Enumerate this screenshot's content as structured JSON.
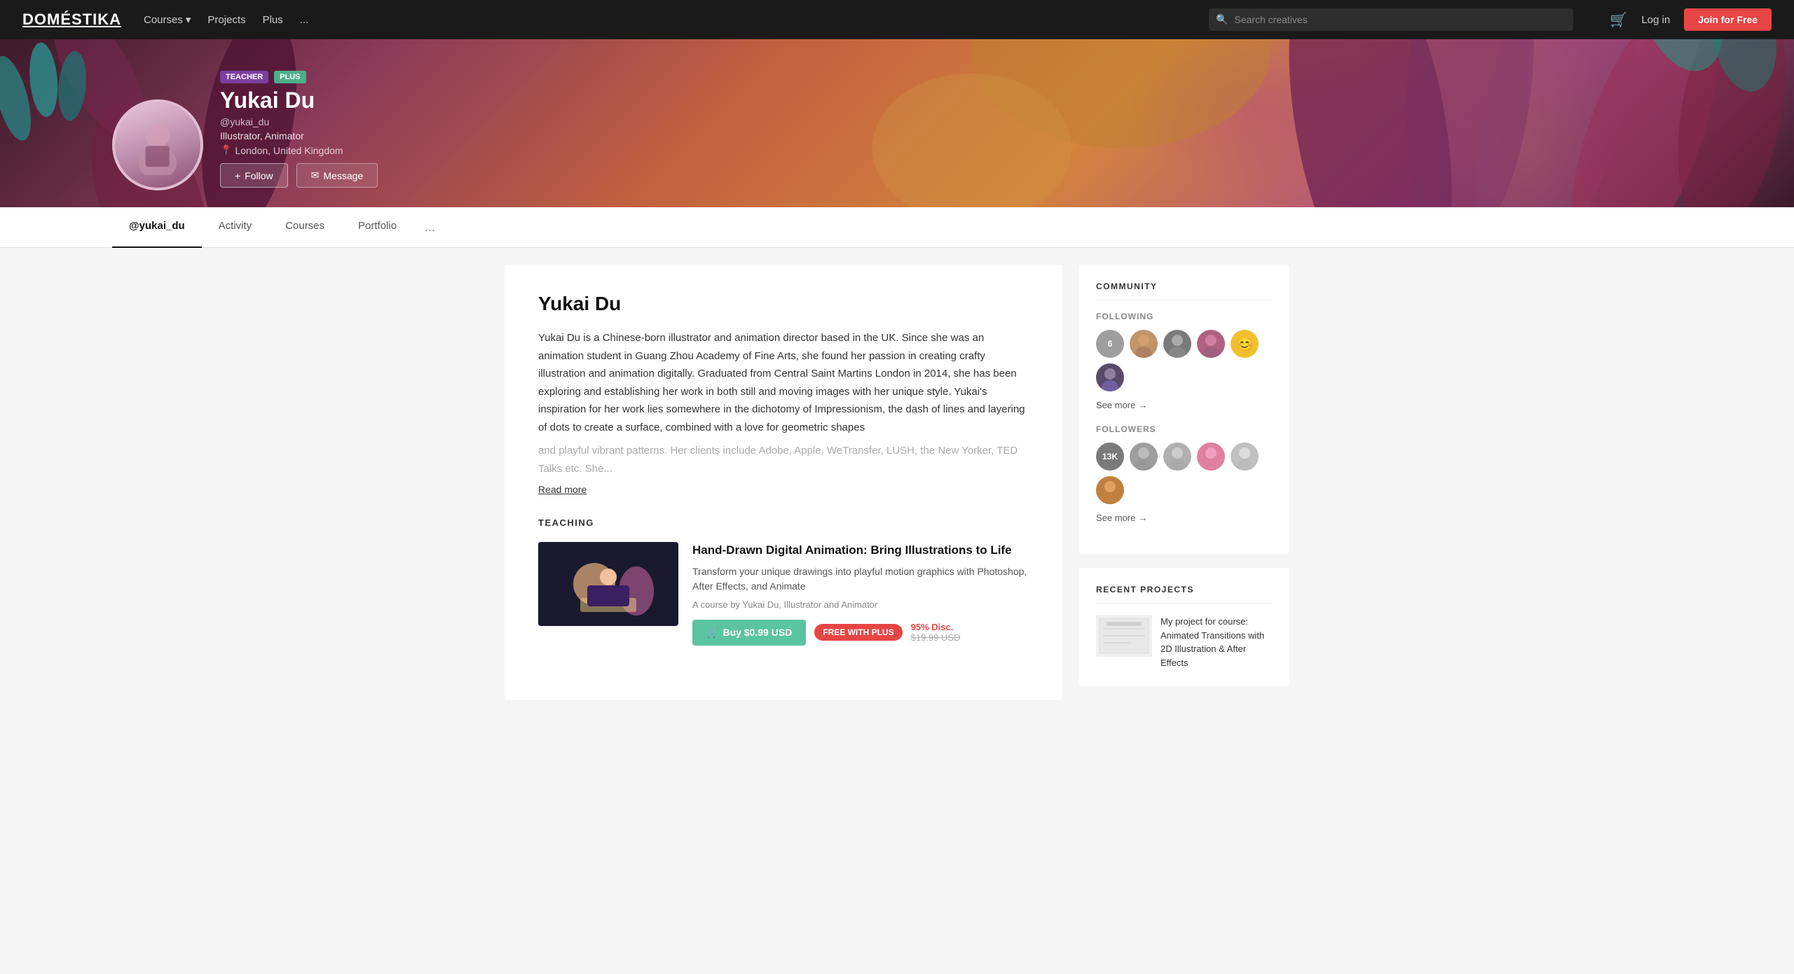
{
  "nav": {
    "logo": "DOMÉSTIKA",
    "links": [
      {
        "label": "Courses",
        "has_dropdown": true
      },
      {
        "label": "Projects"
      },
      {
        "label": "Plus"
      },
      {
        "label": "..."
      }
    ],
    "search_placeholder": "Search creatives",
    "login_label": "Log in",
    "join_label": "Join for Free"
  },
  "profile": {
    "badge_teacher": "TEACHER",
    "badge_plus": "PLUS",
    "name": "Yukai Du",
    "handle": "@yukai_du",
    "title": "Illustrator, Animator",
    "location": "London, United Kingdom",
    "follow_label": "Follow",
    "message_label": "Message"
  },
  "tabs": [
    {
      "label": "@yukai_du",
      "active": true
    },
    {
      "label": "Activity"
    },
    {
      "label": "Courses"
    },
    {
      "label": "Portfolio"
    },
    {
      "label": "..."
    }
  ],
  "bio": {
    "name": "Yukai Du",
    "text_visible": "Yukai Du is a Chinese-born illustrator and animation director based in the UK. Since she was an animation student in Guang Zhou Academy of Fine Arts, she found her passion in creating crafty illustration and animation digitally. Graduated from Central Saint Martins London in 2014, she has been exploring and establishing her work in both still and moving images with her unique style. Yukai's inspiration for her work lies somewhere in the dichotomy of Impressionism, the dash of lines and layering of dots to create a surface, combined with a love for geometric shapes",
    "text_faded": "and playful vibrant patterns. Her clients include Adobe, Apple, WeTransfer, LUSH, the New Yorker, TED Talks etc. She...",
    "read_more": "Read more"
  },
  "teaching": {
    "label": "TEACHING",
    "course": {
      "title": "Hand-Drawn Digital Animation: Bring Illustrations to Life",
      "desc": "Transform your unique drawings into playful motion graphics with Photoshop, After Effects, and Animate",
      "author": "A course by Yukai Du, Illustrator and Animator",
      "buy_label": "Buy $0.99 USD",
      "free_plus_label": "FREE WITH PLUS",
      "discount_label": "95% Disc.",
      "original_price": "$19.99 USD"
    }
  },
  "community": {
    "title": "COMMUNITY",
    "following_label": "FOLLOWING",
    "followers_label": "FOLLOWERS",
    "following_count": "6",
    "followers_count": "13K",
    "see_more_label": "See more",
    "following_avatars": [
      {
        "color": "#9e9e9e",
        "text": "6"
      },
      {
        "color": "#c0956a",
        "text": ""
      },
      {
        "color": "#7a7a7a",
        "text": ""
      },
      {
        "color": "#b06080",
        "text": ""
      },
      {
        "color": "#f0c030",
        "text": "😊"
      },
      {
        "color": "#5a4a6a",
        "text": ""
      }
    ],
    "followers_avatars": [
      {
        "color": "#7a7a7a",
        "text": "13K"
      },
      {
        "color": "#9e9e9e",
        "text": ""
      },
      {
        "color": "#b0b0b0",
        "text": ""
      },
      {
        "color": "#e080a0",
        "text": ""
      },
      {
        "color": "#c0c0c0",
        "text": ""
      },
      {
        "color": "#c08040",
        "text": ""
      }
    ]
  },
  "recent_projects": {
    "title": "RECENT PROJECTS",
    "item": {
      "title": "My project for course: Animated Transitions with 2D Illustration & After Effects"
    }
  }
}
